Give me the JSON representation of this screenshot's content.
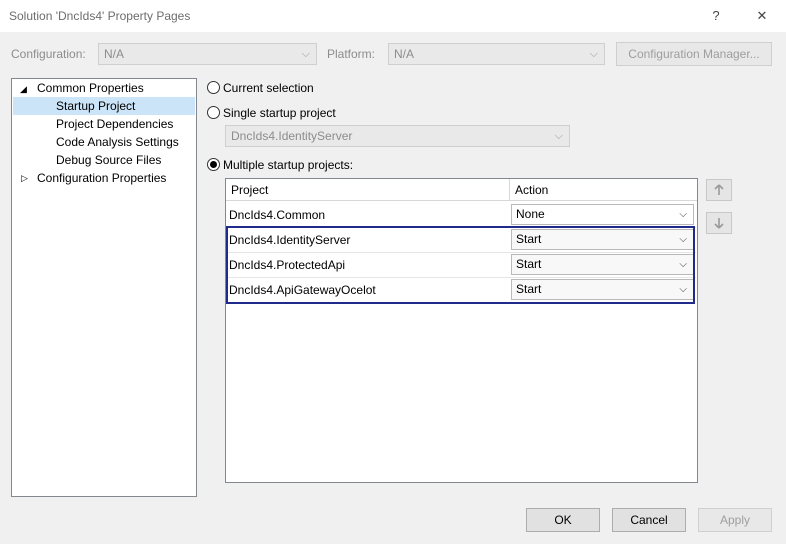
{
  "window": {
    "title": "Solution 'DncIds4' Property Pages",
    "help_glyph": "?",
    "close_glyph": "✕"
  },
  "toolbar": {
    "configuration_label": "Configuration:",
    "configuration_value": "N/A",
    "platform_label": "Platform:",
    "platform_value": "N/A",
    "config_manager_label": "Configuration Manager..."
  },
  "tree": {
    "items": [
      {
        "label": "Common Properties",
        "expander": "◢"
      },
      {
        "label": "Startup Project"
      },
      {
        "label": "Project Dependencies"
      },
      {
        "label": "Code Analysis Settings"
      },
      {
        "label": "Debug Source Files"
      },
      {
        "label": "Configuration Properties",
        "expander": "▷"
      }
    ]
  },
  "startup": {
    "current_selection": "Current selection",
    "single_startup": "Single startup project",
    "single_value": "DncIds4.IdentityServer",
    "multiple_startup": "Multiple startup projects:",
    "selected_mode": "multiple"
  },
  "grid": {
    "columns": [
      "Project",
      "Action"
    ],
    "rows": [
      {
        "project": "DncIds4.Common",
        "action": "None"
      },
      {
        "project": "DncIds4.IdentityServer",
        "action": "Start"
      },
      {
        "project": "DncIds4.ProtectedApi",
        "action": "Start"
      },
      {
        "project": "DncIds4.ApiGatewayOcelot",
        "action": "Start"
      }
    ],
    "highlight_color": "#1f2a8a"
  },
  "footer": {
    "ok": "OK",
    "cancel": "Cancel",
    "apply": "Apply"
  },
  "icons": {
    "move_up": "arrow-up-icon",
    "move_down": "arrow-down-icon",
    "dropdown": "chevron-down-icon"
  }
}
